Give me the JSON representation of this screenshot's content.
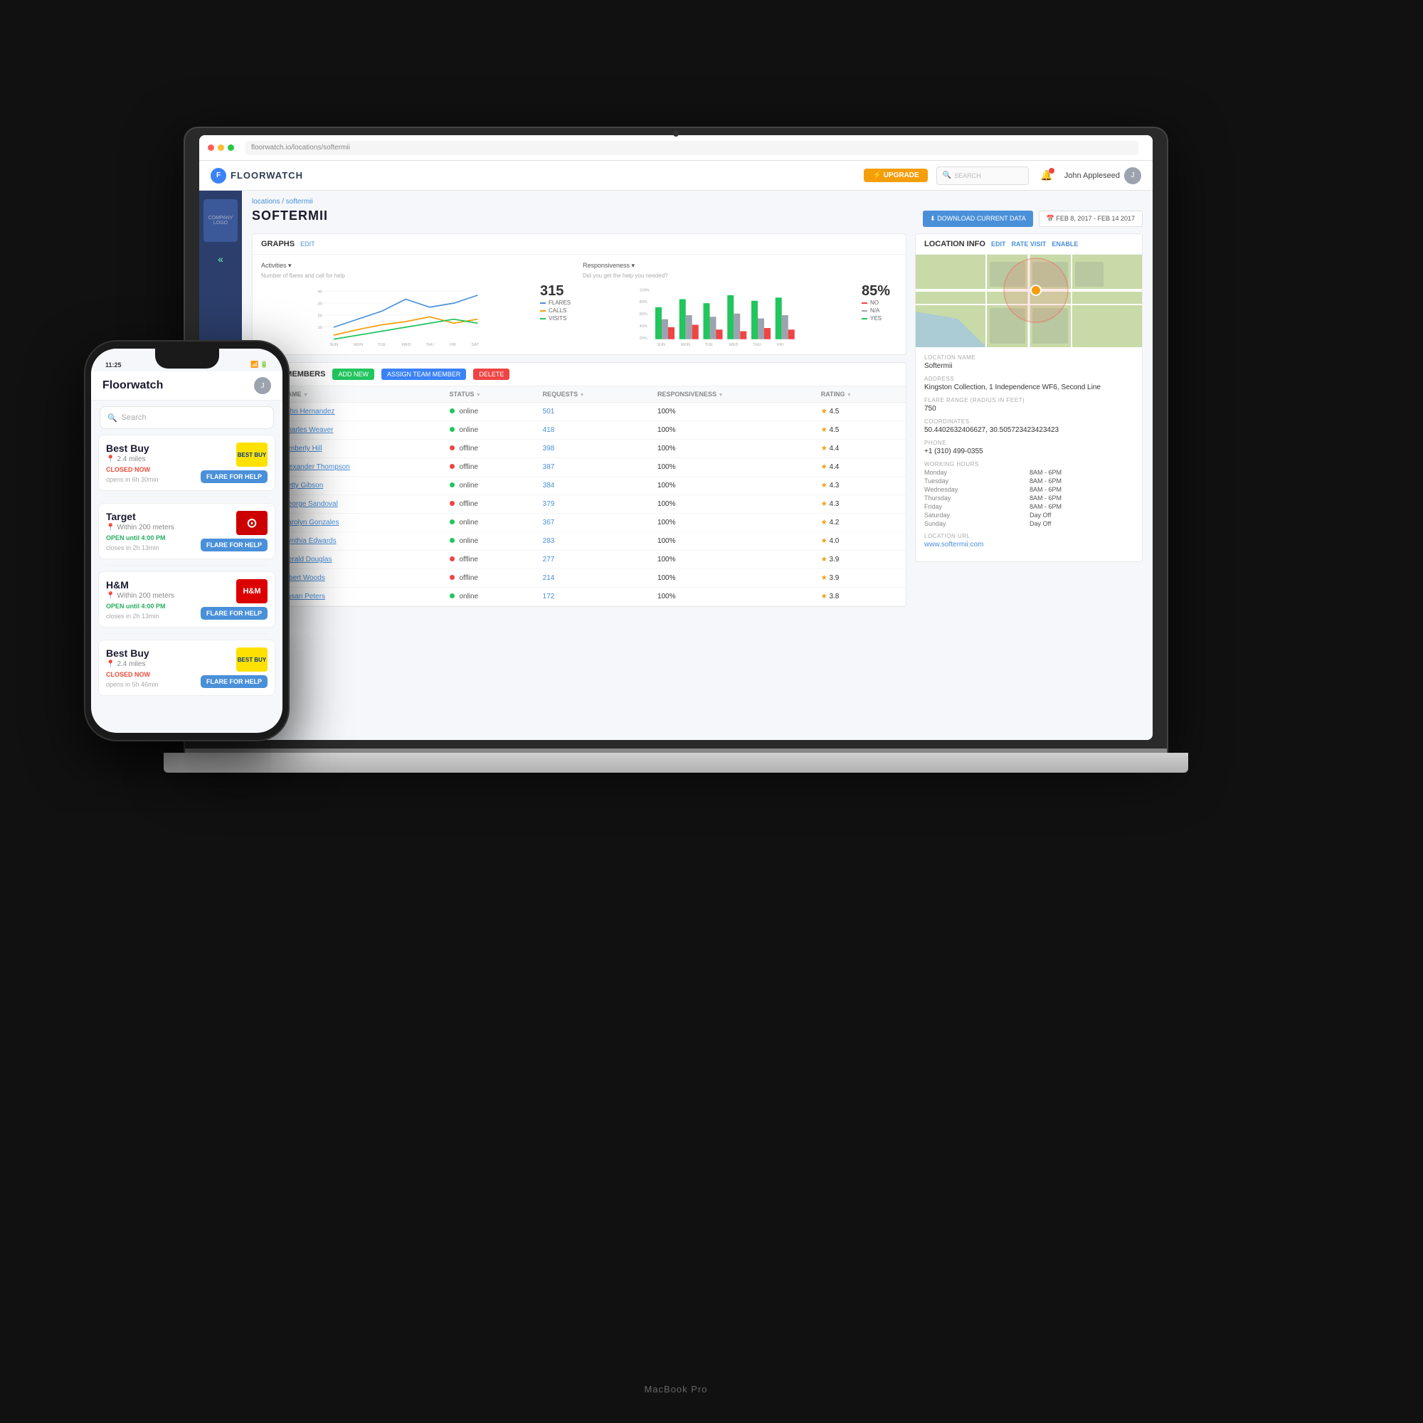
{
  "scene": {
    "bg": "#111"
  },
  "laptop": {
    "label": "MacBook Pro",
    "camera_label": "camera"
  },
  "app": {
    "url": "floorwatch.io/locations/softermii",
    "logo_icon": "F",
    "logo_text": "FLOORWATCH",
    "header": {
      "upgrade_label": "⚡ UPGRADE",
      "search_placeholder": "SEARCH",
      "user_name": "John Appleseed",
      "notif_icon": "🔔"
    },
    "breadcrumb": "locations / softermii",
    "page_title": "SOFTERMII",
    "download_btn": "⬇ DOWNLOAD CURRENT DATA",
    "date_range": "📅  FEB 8, 2017 - FEB 14 2017",
    "graphs_label": "GRAPHS",
    "graphs_edit": "EDIT",
    "activities_label": "Activities ▾",
    "activities_sublabel": "Number of flares and call for help",
    "activities_big_num": "315",
    "activities_legend": [
      {
        "label": "FLARES",
        "color": "#4a90d9"
      },
      {
        "label": "CALLS",
        "color": "#f59e0b"
      },
      {
        "label": "VISITS",
        "color": "#22c55e"
      }
    ],
    "responsiveness_label": "Responsiveness ▾",
    "responsiveness_sublabel": "Did you get the help you needed?",
    "responsiveness_big_num": "85%",
    "responsiveness_legend": [
      {
        "label": "NO",
        "color": "#ef4444"
      },
      {
        "label": "N/A",
        "color": "#9ca3af"
      },
      {
        "label": "YES",
        "color": "#22c55e"
      }
    ],
    "chart_days": [
      "SUN",
      "MON",
      "TUE",
      "WED",
      "THU",
      "FRI",
      "SAT"
    ],
    "team_members_label": "TEAM MEMBERS",
    "add_new_btn": "ADD NEW",
    "assign_btn": "ASSIGN TEAM MEMBER",
    "delete_btn": "DELETE",
    "table_cols": [
      "NAME",
      "STATUS",
      "REQUESTS",
      "RESPONSIVENESS",
      "RATING"
    ],
    "members": [
      {
        "name": "John Hernandez",
        "status": "online",
        "requests": "501",
        "responsiveness": "100%",
        "rating": "4.5"
      },
      {
        "name": "Charles Weaver",
        "status": "online",
        "requests": "418",
        "responsiveness": "100%",
        "rating": "4.5"
      },
      {
        "name": "Kimberly Hill",
        "status": "offline",
        "requests": "398",
        "responsiveness": "100%",
        "rating": "4.4"
      },
      {
        "name": "Alexander Thompson",
        "status": "offline",
        "requests": "387",
        "responsiveness": "100%",
        "rating": "4.4"
      },
      {
        "name": "Betty Gibson",
        "status": "online",
        "requests": "384",
        "responsiveness": "100%",
        "rating": "4.3"
      },
      {
        "name": "George Sandoval",
        "status": "offline",
        "requests": "379",
        "responsiveness": "100%",
        "rating": "4.3"
      },
      {
        "name": "Carolyn Gonzales",
        "status": "online",
        "requests": "367",
        "responsiveness": "100%",
        "rating": "4.2"
      },
      {
        "name": "Cynthia Edwards",
        "status": "online",
        "requests": "283",
        "responsiveness": "100%",
        "rating": "4.0"
      },
      {
        "name": "Gerald Douglas",
        "status": "offline",
        "requests": "277",
        "responsiveness": "100%",
        "rating": "3.9"
      },
      {
        "name": "Albert Woods",
        "status": "offline",
        "requests": "214",
        "responsiveness": "100%",
        "rating": "3.9"
      },
      {
        "name": "Susan Peters",
        "status": "online",
        "requests": "172",
        "responsiveness": "100%",
        "rating": "3.8"
      }
    ],
    "location_info_label": "LOCATION INFO",
    "li_edit": "EDIT",
    "li_rate": "RATE VISIT",
    "li_enable": "ENABLE",
    "location_name_label": "Location Name",
    "location_name": "Softermii",
    "address_label": "Address",
    "address": "Kingston Collection, 1 Independence WF6, Second Line",
    "flare_range_label": "Flare Range (radius in feet)",
    "flare_range": "750",
    "coordinates_label": "Coordinates",
    "coordinates": "50.4402632406627, 30.505723423423423",
    "phone_label": "Phone",
    "phone": "+1 (310) 499-0355",
    "working_hours_label": "Working Hours",
    "hours": [
      {
        "day": "Monday",
        "hours": "8AM - 6PM"
      },
      {
        "day": "Tuesday",
        "hours": "8AM - 6PM"
      },
      {
        "day": "Wednesday",
        "hours": "8AM - 6PM"
      },
      {
        "day": "Thursday",
        "hours": "8AM - 6PM"
      },
      {
        "day": "Friday",
        "hours": "8AM - 6PM"
      },
      {
        "day": "Saturday",
        "hours": "Day Off"
      },
      {
        "day": "Sunday",
        "hours": "Day Off"
      }
    ],
    "location_url_label": "Location URL",
    "location_url": "www.softermii.com"
  },
  "phone": {
    "time": "11:25",
    "app_title": "Floorwatch",
    "search_placeholder": "Search",
    "stores": [
      {
        "name": "Best Buy",
        "distance": "2.4 miles",
        "status": "CLOSED NOW",
        "status_type": "closed",
        "opens": "opens in 6h 30min",
        "logo_type": "bestbuy",
        "logo_text": "BEST BUY",
        "flare_btn": "FLARE FOR HELP"
      },
      {
        "name": "Target",
        "distance": "Within 200 meters",
        "status": "OPEN until 4:00 PM",
        "status_type": "open",
        "opens": "closes in 2h 13min",
        "logo_type": "target",
        "logo_text": "T",
        "flare_btn": "FLARE FOR HELP"
      },
      {
        "name": "H&M",
        "distance": "Within 200 meters",
        "status": "OPEN until 4:00 PM",
        "status_type": "open",
        "opens": "closes in 2h 13min",
        "logo_type": "hm",
        "logo_text": "H&M",
        "flare_btn": "FLARE FOR HELP"
      },
      {
        "name": "Best Buy",
        "distance": "2.4 miles",
        "status": "CLOSED NOW",
        "status_type": "closed",
        "opens": "opens in 5h 46min",
        "logo_type": "bestbuy",
        "logo_text": "BEST BUY",
        "flare_btn": "FLARE FOR HELP"
      }
    ]
  }
}
